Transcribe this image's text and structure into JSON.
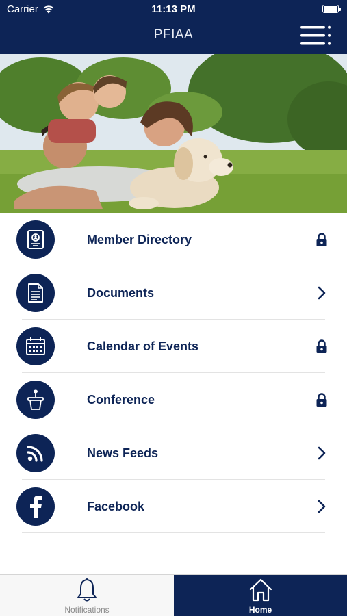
{
  "status_bar": {
    "carrier": "Carrier",
    "time": "11:13 PM"
  },
  "nav": {
    "title": "PFIAA",
    "menu_icon": "hamburger-menu-icon"
  },
  "hero": {
    "icon": "family-with-dog-photo"
  },
  "menu": {
    "items": [
      {
        "label": "Member Directory",
        "icon": "member-id-icon",
        "trailing": "lock-icon"
      },
      {
        "label": "Documents",
        "icon": "document-icon",
        "trailing": "chevron-right-icon"
      },
      {
        "label": "Calendar of Events",
        "icon": "calendar-icon",
        "trailing": "lock-icon"
      },
      {
        "label": "Conference",
        "icon": "podium-icon",
        "trailing": "lock-icon"
      },
      {
        "label": "News Feeds",
        "icon": "rss-icon",
        "trailing": "chevron-right-icon"
      },
      {
        "label": "Facebook",
        "icon": "facebook-icon",
        "trailing": "chevron-right-icon"
      }
    ]
  },
  "tabbar": {
    "notifications_label": "Notifications",
    "home_label": "Home",
    "active": "Home"
  },
  "colors": {
    "primary": "#0d2456",
    "divider": "#e3e3e3",
    "inactive_tab_text": "#8a8a8a"
  }
}
